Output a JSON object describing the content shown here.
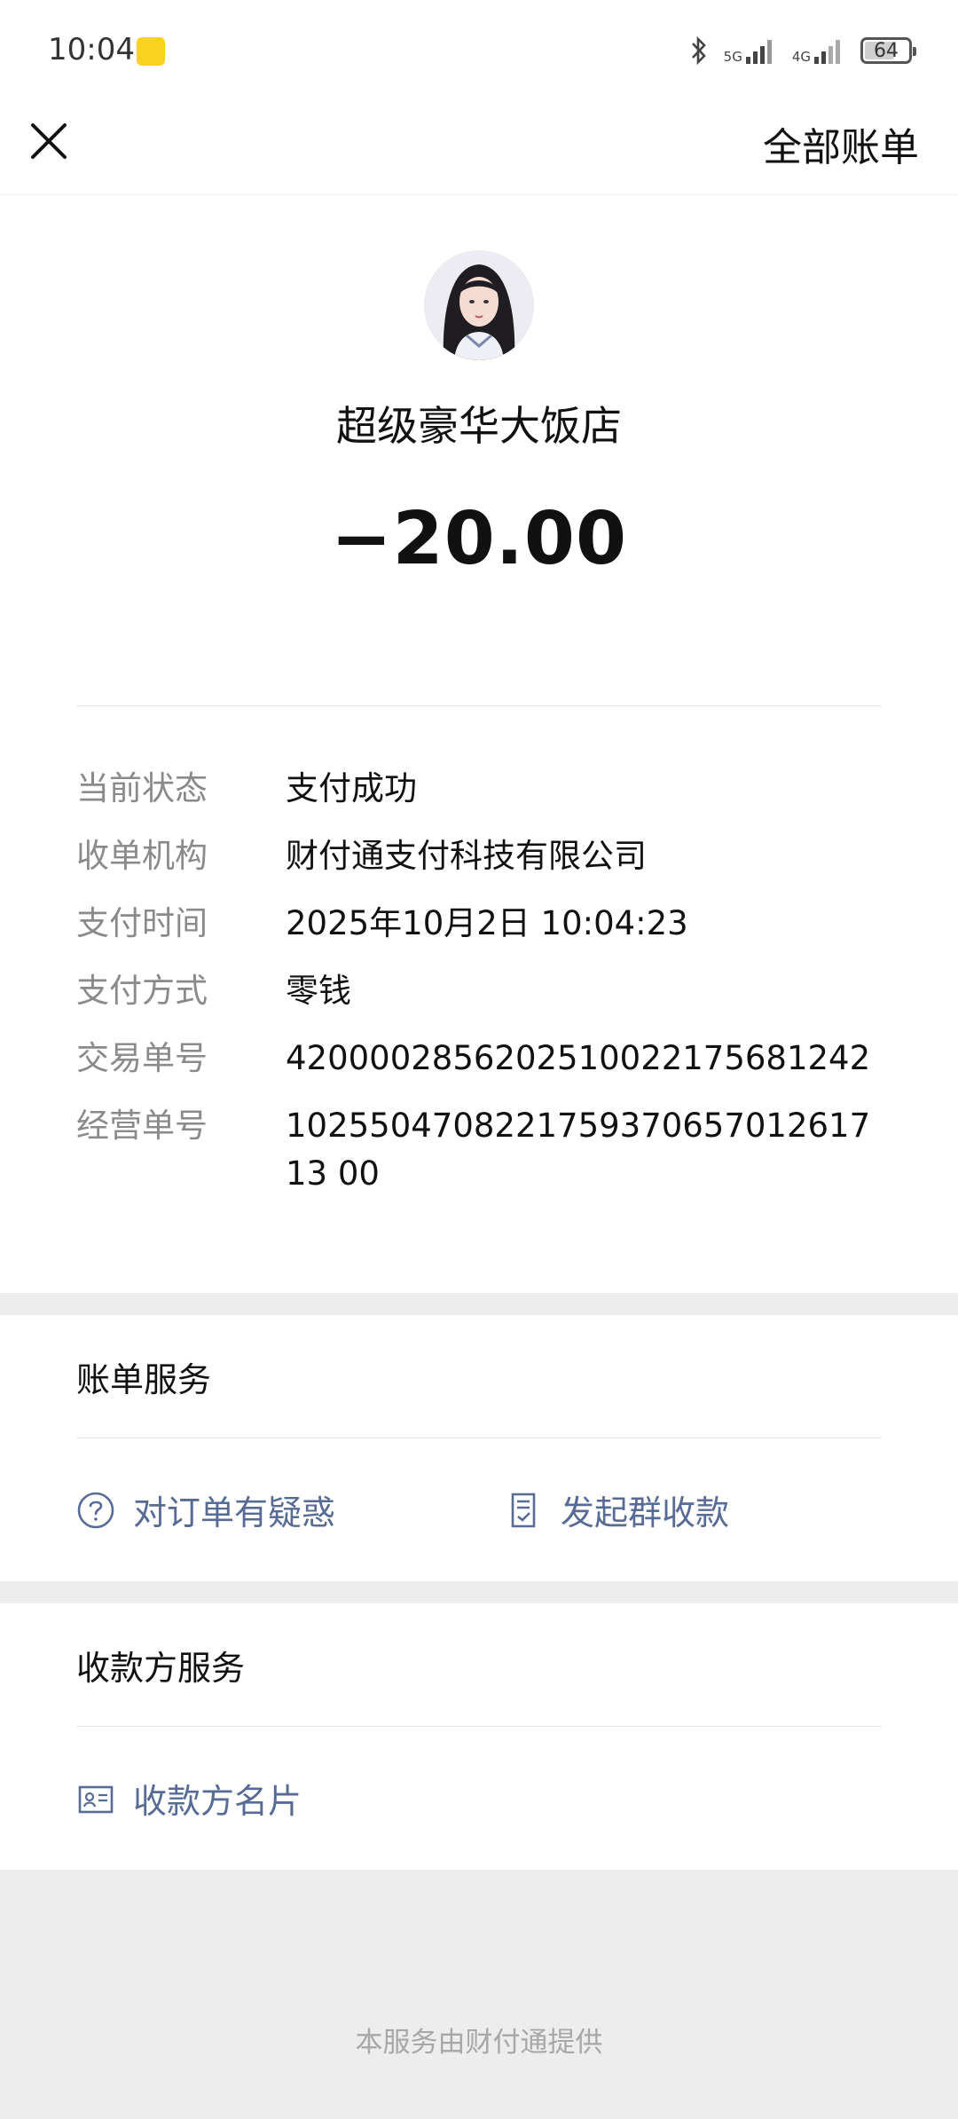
{
  "status_bar": {
    "time": "10:04",
    "network_1": "5G",
    "network_2": "4G",
    "battery": "64"
  },
  "nav": {
    "close_icon": "close-icon",
    "right_label": "全部账单"
  },
  "transaction": {
    "merchant_name": "超级豪华大饭店",
    "amount": "−20.00",
    "details": [
      {
        "label": "当前状态",
        "value": "支付成功"
      },
      {
        "label": "收单机构",
        "value": "财付通支付科技有限公司"
      },
      {
        "label": "支付时间",
        "value": "2025年10月2日 10:04:23"
      },
      {
        "label": "支付方式",
        "value": "零钱"
      },
      {
        "label": "交易单号",
        "value": "4200002856202510022175681242"
      },
      {
        "label": "经营单号",
        "value": "102550470822175937065701261713 00"
      }
    ]
  },
  "bill_service": {
    "title": "账单服务",
    "question_label": "对订单有疑惑",
    "group_collect_label": "发起群收款"
  },
  "payee_service": {
    "title": "收款方服务",
    "card_label": "收款方名片"
  },
  "footer": "本服务由财付通提供",
  "colors": {
    "link": "#576b95",
    "label": "#8a8a8a",
    "background": "#ededed"
  }
}
